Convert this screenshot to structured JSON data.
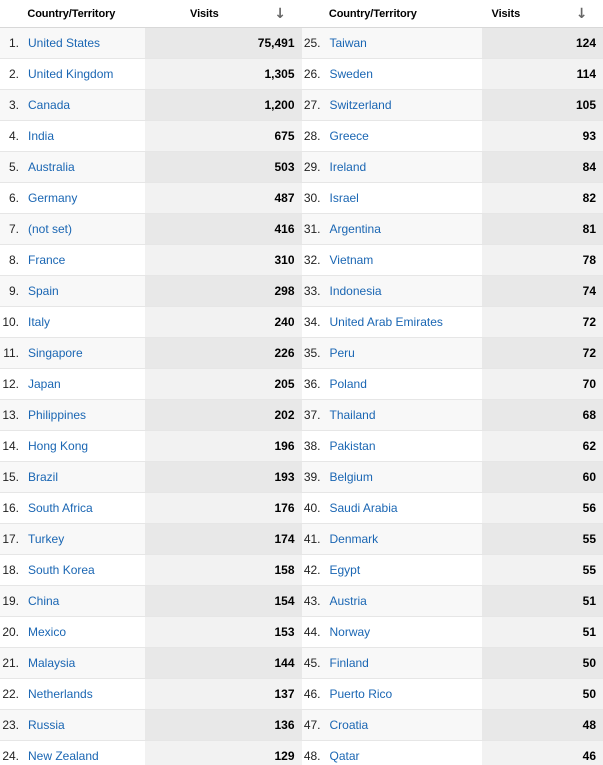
{
  "header": {
    "country_label": "Country/Territory",
    "visits_label": "Visits",
    "sort_icon": "↓",
    "sort_direction": "descending"
  },
  "colors": {
    "link": "#1a66b3",
    "row_odd": "#f8f8f8",
    "row_even": "#ffffff",
    "metric_odd": "#e8e8e8",
    "metric_even": "#f2f2f2",
    "border": "#e6e6e6",
    "arrow": "#666666"
  },
  "table": {
    "columns": [
      "Country/Territory",
      "Visits"
    ],
    "left_rows": [
      {
        "index": "1.",
        "country": "United States",
        "visits": "75,491"
      },
      {
        "index": "2.",
        "country": "United Kingdom",
        "visits": "1,305"
      },
      {
        "index": "3.",
        "country": "Canada",
        "visits": "1,200"
      },
      {
        "index": "4.",
        "country": "India",
        "visits": "675"
      },
      {
        "index": "5.",
        "country": "Australia",
        "visits": "503"
      },
      {
        "index": "6.",
        "country": "Germany",
        "visits": "487"
      },
      {
        "index": "7.",
        "country": "(not set)",
        "visits": "416"
      },
      {
        "index": "8.",
        "country": "France",
        "visits": "310"
      },
      {
        "index": "9.",
        "country": "Spain",
        "visits": "298"
      },
      {
        "index": "10.",
        "country": "Italy",
        "visits": "240"
      },
      {
        "index": "11.",
        "country": "Singapore",
        "visits": "226"
      },
      {
        "index": "12.",
        "country": "Japan",
        "visits": "205"
      },
      {
        "index": "13.",
        "country": "Philippines",
        "visits": "202"
      },
      {
        "index": "14.",
        "country": "Hong Kong",
        "visits": "196"
      },
      {
        "index": "15.",
        "country": "Brazil",
        "visits": "193"
      },
      {
        "index": "16.",
        "country": "South Africa",
        "visits": "176"
      },
      {
        "index": "17.",
        "country": "Turkey",
        "visits": "174"
      },
      {
        "index": "18.",
        "country": "South Korea",
        "visits": "158"
      },
      {
        "index": "19.",
        "country": "China",
        "visits": "154"
      },
      {
        "index": "20.",
        "country": "Mexico",
        "visits": "153"
      },
      {
        "index": "21.",
        "country": "Malaysia",
        "visits": "144"
      },
      {
        "index": "22.",
        "country": "Netherlands",
        "visits": "137"
      },
      {
        "index": "23.",
        "country": "Russia",
        "visits": "136"
      },
      {
        "index": "24.",
        "country": "New Zealand",
        "visits": "129"
      }
    ],
    "right_rows": [
      {
        "index": "25.",
        "country": "Taiwan",
        "visits": "124"
      },
      {
        "index": "26.",
        "country": "Sweden",
        "visits": "114"
      },
      {
        "index": "27.",
        "country": "Switzerland",
        "visits": "105"
      },
      {
        "index": "28.",
        "country": "Greece",
        "visits": "93"
      },
      {
        "index": "29.",
        "country": "Ireland",
        "visits": "84"
      },
      {
        "index": "30.",
        "country": "Israel",
        "visits": "82"
      },
      {
        "index": "31.",
        "country": "Argentina",
        "visits": "81"
      },
      {
        "index": "32.",
        "country": "Vietnam",
        "visits": "78"
      },
      {
        "index": "33.",
        "country": "Indonesia",
        "visits": "74"
      },
      {
        "index": "34.",
        "country": "United Arab Emirates",
        "visits": "72"
      },
      {
        "index": "35.",
        "country": "Peru",
        "visits": "72"
      },
      {
        "index": "36.",
        "country": "Poland",
        "visits": "70"
      },
      {
        "index": "37.",
        "country": "Thailand",
        "visits": "68"
      },
      {
        "index": "38.",
        "country": "Pakistan",
        "visits": "62"
      },
      {
        "index": "39.",
        "country": "Belgium",
        "visits": "60"
      },
      {
        "index": "40.",
        "country": "Saudi Arabia",
        "visits": "56"
      },
      {
        "index": "41.",
        "country": "Denmark",
        "visits": "55"
      },
      {
        "index": "42.",
        "country": "Egypt",
        "visits": "55"
      },
      {
        "index": "43.",
        "country": "Austria",
        "visits": "51"
      },
      {
        "index": "44.",
        "country": "Norway",
        "visits": "51"
      },
      {
        "index": "45.",
        "country": "Finland",
        "visits": "50"
      },
      {
        "index": "46.",
        "country": "Puerto Rico",
        "visits": "50"
      },
      {
        "index": "47.",
        "country": "Croatia",
        "visits": "48"
      },
      {
        "index": "48.",
        "country": "Qatar",
        "visits": "46"
      }
    ]
  }
}
